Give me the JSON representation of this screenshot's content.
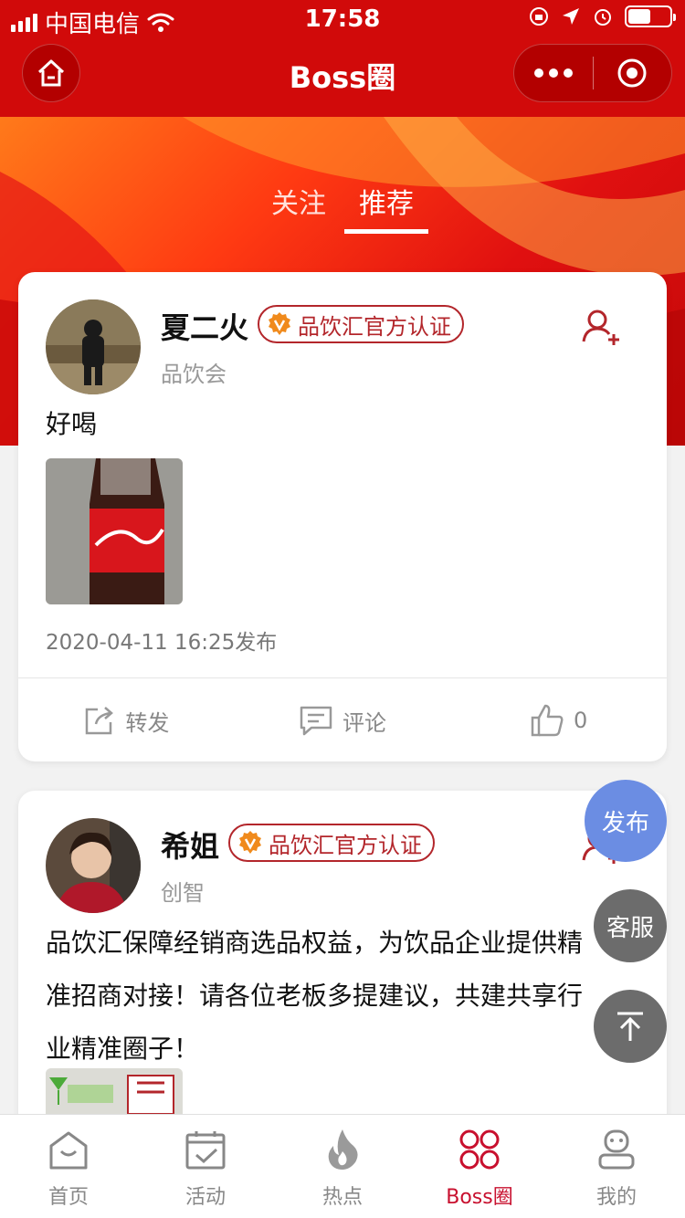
{
  "status": {
    "carrier": "中国电信",
    "time": "17:58"
  },
  "nav": {
    "title": "Boss圈"
  },
  "tabs": [
    {
      "label": "关注",
      "active": false
    },
    {
      "label": "推荐",
      "active": true
    }
  ],
  "posts": [
    {
      "name": "夏二火",
      "badge": "品饮汇官方认证",
      "company": "品饮会",
      "text": "好喝",
      "time": "2020-04-11 16:25发布",
      "actions": {
        "share": "转发",
        "comment": "评论",
        "likes": "0"
      }
    },
    {
      "name": "希姐",
      "badge": "品饮汇官方认证",
      "company": "创智",
      "text_lines": [
        "品饮汇保障经销商选品权益，为饮品企业提供精",
        "准招商对接！请各位老板多提建议，共建共享行",
        "业精准圈子！"
      ]
    }
  ],
  "floating": {
    "publish": "发布",
    "service": "客服"
  },
  "tabbar": [
    {
      "label": "首页",
      "icon": "home-icon",
      "active": false
    },
    {
      "label": "活动",
      "icon": "calendar-check-icon",
      "active": false
    },
    {
      "label": "热点",
      "icon": "flame-icon",
      "active": false
    },
    {
      "label": "Boss圈",
      "icon": "boss-circle-icon",
      "active": true
    },
    {
      "label": "我的",
      "icon": "profile-icon",
      "active": false
    }
  ],
  "colors": {
    "primary_red": "#d10a0a",
    "badge_red": "#b3262b",
    "active_tab": "#c8102e",
    "publish_blue": "#6b8de3",
    "float_gray": "#6c6c6c"
  }
}
